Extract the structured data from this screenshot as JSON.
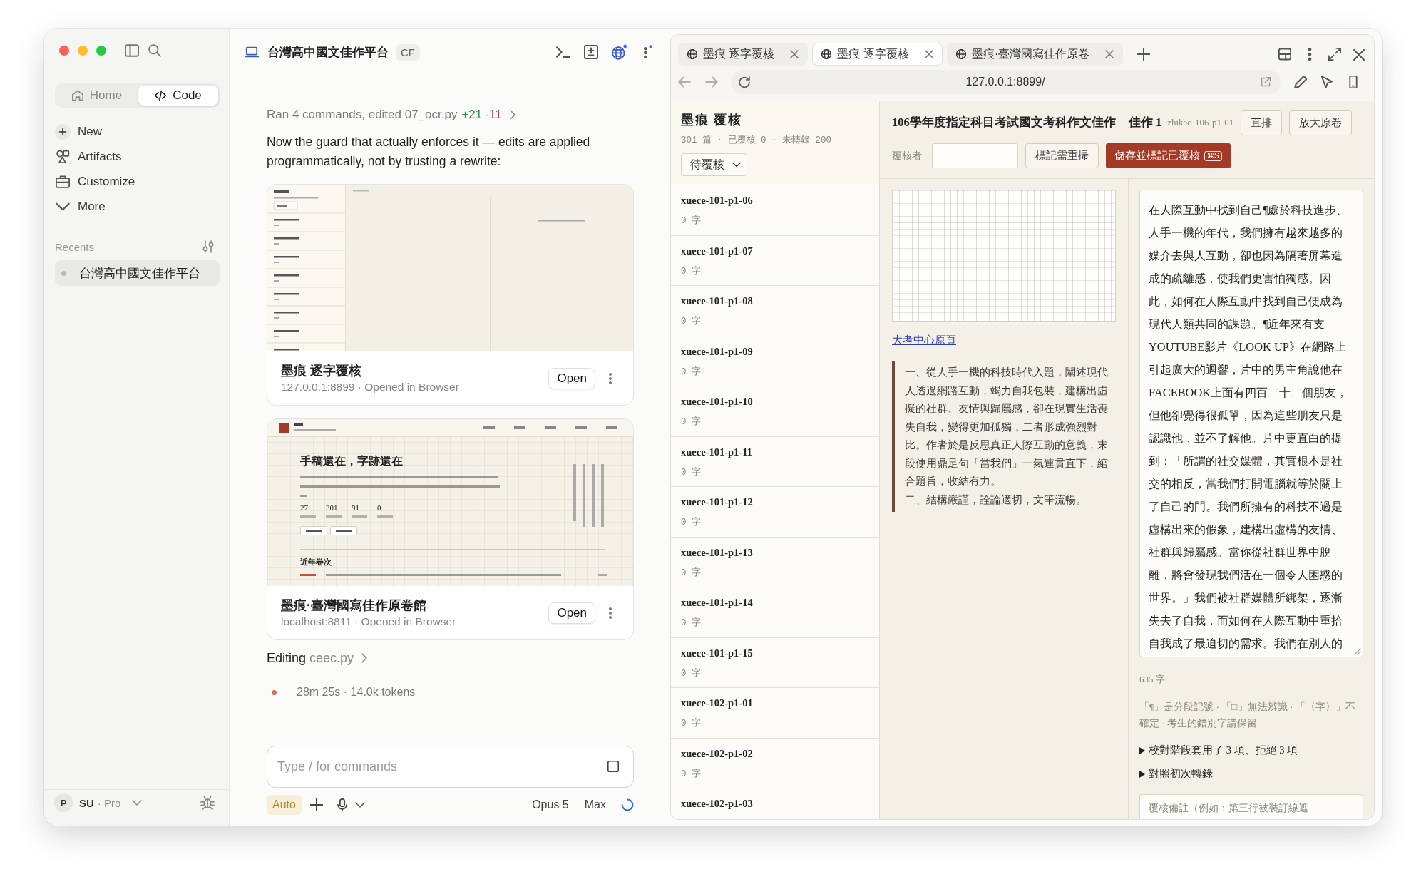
{
  "sidebar": {
    "mode_tabs": [
      {
        "label": "Home",
        "kind": "home",
        "selected": false
      },
      {
        "label": "Code",
        "kind": "code",
        "selected": true
      }
    ],
    "nav_items": [
      {
        "label": "New",
        "kind": "new"
      },
      {
        "label": "Artifacts",
        "kind": "artifacts"
      },
      {
        "label": "Customize",
        "kind": "customize"
      },
      {
        "label": "More",
        "kind": "more"
      }
    ],
    "recents_label": "Recents",
    "recents": [
      {
        "title": "台灣高中國文佳作平台",
        "selected": true
      }
    ],
    "user": {
      "initial": "P",
      "name": "SU",
      "plan": "· Pro"
    }
  },
  "chat": {
    "title": "台灣高中國文佳作平台",
    "badge": "CF",
    "activity": {
      "text": "Ran 4 commands, edited 07_ocr.py",
      "added": "+21",
      "removed": "-11"
    },
    "message": "Now the guard that actually enforces it — edits are applied programmatically, not by trusting a rewrite:",
    "artifacts": [
      {
        "title": "墨痕 逐字覆核",
        "subtitle": "127.0.0.1:8899 · Opened in Browser",
        "button": "Open",
        "preview": {
          "kind": "review"
        }
      },
      {
        "title": "墨痕·臺灣國寫佳作原卷館",
        "subtitle": "localhost:8811 · Opened in Browser",
        "button": "Open",
        "preview": {
          "kind": "landing",
          "headline": "手稿還在，字跡還在",
          "stats": [
            "27",
            "301",
            "91",
            "0"
          ],
          "section": "近年卷次"
        }
      }
    ],
    "editing": {
      "label": "Editing",
      "file": "ceec.py"
    },
    "status": "28m 25s · 14.0k tokens",
    "composer": {
      "placeholder": "Type / for commands"
    },
    "toolbar": {
      "mode": "Auto",
      "model": "Opus 5",
      "effort": "Max"
    }
  },
  "browser": {
    "tabs": [
      {
        "title": "墨痕 逐字覆核",
        "selected": false
      },
      {
        "title": "墨痕 逐字覆核",
        "selected": true
      },
      {
        "title": "墨痕·臺灣國寫佳作原卷",
        "selected": false
      }
    ],
    "url": "127.0.0.1:8899/",
    "page": {
      "list": {
        "title": "墨痕 覆核",
        "stats": "301 篇 · 已覆核 0 · 未轉錄 200",
        "filter": "待覆核",
        "items": [
          {
            "id": "xuece-101-p1-06",
            "count": "0 字"
          },
          {
            "id": "xuece-101-p1-07",
            "count": "0 字"
          },
          {
            "id": "xuece-101-p1-08",
            "count": "0 字"
          },
          {
            "id": "xuece-101-p1-09",
            "count": "0 字"
          },
          {
            "id": "xuece-101-p1-10",
            "count": "0 字"
          },
          {
            "id": "xuece-101-p1-11",
            "count": "0 字"
          },
          {
            "id": "xuece-101-p1-12",
            "count": "0 字"
          },
          {
            "id": "xuece-101-p1-13",
            "count": "0 字"
          },
          {
            "id": "xuece-101-p1-14",
            "count": "0 字"
          },
          {
            "id": "xuece-101-p1-15",
            "count": "0 字"
          },
          {
            "id": "xuece-102-p1-01",
            "count": "0 字"
          },
          {
            "id": "xuece-102-p1-02",
            "count": "0 字"
          },
          {
            "id": "xuece-102-p1-03"
          }
        ]
      },
      "essay": {
        "title": "106學年度指定科目考試國文考科作文佳作",
        "award": "佳作 1",
        "code": "zhikao-106-p1-01",
        "actions": [
          "直排",
          "放大原卷"
        ],
        "reviewer_label": "覆核者",
        "rescan_button": "標記需重掃",
        "save_button": "儲存並標記已覆核",
        "save_shortcut": "⌘S"
      },
      "source_link": "大考中心原頁",
      "comment_lines": [
        "一、從人手一機的科技時代入題，闡述現代",
        "人透過網路互動，竭力自我包裝，建構出虛",
        "擬的社群、友情與歸屬感，卻在現實生活喪",
        "失自我，變得更加孤獨，二者形成強烈對",
        "比。作者於是反思真正人際互動的意義，末",
        "段使用鼎足句「當我們」一氣連貫直下，綰",
        "合題旨，收結有力。",
        "二、結構嚴謹，詮論適切，文筆流暢。"
      ],
      "transcript_lines": [
        "在人際互動中找到自己¶處於科技進步、",
        "人手一機的年代，我們擁有越來越多的",
        "媒介去與人互動，卻也因為隔著屏幕造",
        "成的疏離感，使我們更害怕獨感。因",
        "此，如何在人際互動中找到自己便成為",
        "現代人類共同的課題。¶近年來有支",
        "YOUTUBE影片《LOOK UP》在網路上",
        "引起廣大的迴響，片中的男主角說他在",
        "FACEBOOK上面有四百二十二個朋友，",
        "但他卻覺得很孤單，因為這些朋友只是",
        "認識他，並不了解他。片中更直白的提",
        "到：「所謂的社交媒體，其實根本是社",
        "交的相反，當我們打開電腦就等於關上",
        "了自己的門。我們所擁有的科技不過是",
        "虛構出來的假象，建構出虛構的友情、",
        "社群與歸屬感。當你從社群世界中脫",
        "離，將會發現我們活在一個令人困惑的",
        "世界。」我們被社群媒體所綁架，逐漸",
        "失去了自我，而如何在人際互動中重拾",
        "自我成了最迫切的需求。我們在別人的"
      ],
      "char_count": "635 字",
      "legend": "「¶」是分段記號 · 「□」無法辨識 · 「〈字〉」不確定 · 考生的錯別字請保留",
      "details": [
        {
          "summary": "校對階段套用了 3 項、拒絕 3 項",
          "expanded": false
        },
        {
          "summary": "對照初次轉錄",
          "expanded": false
        }
      ],
      "notes": {
        "placeholder": "覆核備註（例如：第三行被裝訂線遮"
      }
    }
  }
}
